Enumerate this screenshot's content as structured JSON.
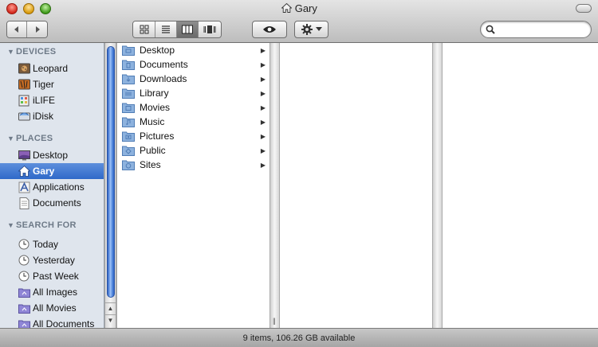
{
  "window": {
    "title": "Gary",
    "title_icon": "home-icon"
  },
  "toolbar": {
    "back_icon": "back-arrow-icon",
    "forward_icon": "forward-arrow-icon",
    "view_modes": [
      {
        "name": "icon-view",
        "active": false
      },
      {
        "name": "list-view",
        "active": false
      },
      {
        "name": "column-view",
        "active": true
      },
      {
        "name": "cover-flow-view",
        "active": false
      }
    ],
    "quick_look_icon": "eye-icon",
    "action_icon": "gear-icon",
    "search": {
      "value": "",
      "placeholder": ""
    }
  },
  "sidebar": {
    "devices_header": "DEVICES",
    "devices": [
      {
        "label": "Leopard",
        "icon": "hard-drive-icon"
      },
      {
        "label": "Tiger",
        "icon": "hard-drive-icon"
      },
      {
        "label": "iLIFE",
        "icon": "disk-image-icon"
      },
      {
        "label": "iDisk",
        "icon": "idisk-icon"
      }
    ],
    "places_header": "PLACES",
    "places": [
      {
        "label": "Desktop",
        "icon": "desktop-icon",
        "selected": false
      },
      {
        "label": "Gary",
        "icon": "home-icon",
        "selected": true
      },
      {
        "label": "Applications",
        "icon": "applications-icon",
        "selected": false
      },
      {
        "label": "Documents",
        "icon": "document-icon",
        "selected": false
      }
    ],
    "search_header": "SEARCH FOR",
    "searches": [
      {
        "label": "Today",
        "icon": "clock-icon"
      },
      {
        "label": "Yesterday",
        "icon": "clock-icon"
      },
      {
        "label": "Past Week",
        "icon": "clock-icon"
      },
      {
        "label": "All Images",
        "icon": "smart-folder-icon"
      },
      {
        "label": "All Movies",
        "icon": "smart-folder-icon"
      },
      {
        "label": "All Documents",
        "icon": "smart-folder-icon"
      }
    ]
  },
  "column1": {
    "items": [
      {
        "label": "Desktop",
        "icon": "folder-icon"
      },
      {
        "label": "Documents",
        "icon": "folder-icon"
      },
      {
        "label": "Downloads",
        "icon": "folder-icon"
      },
      {
        "label": "Library",
        "icon": "folder-icon"
      },
      {
        "label": "Movies",
        "icon": "folder-icon"
      },
      {
        "label": "Music",
        "icon": "folder-icon"
      },
      {
        "label": "Pictures",
        "icon": "folder-icon"
      },
      {
        "label": "Public",
        "icon": "folder-icon"
      },
      {
        "label": "Sites",
        "icon": "folder-icon"
      }
    ]
  },
  "status": {
    "text": "9 items, 106.26 GB available"
  },
  "colors": {
    "sidebar_bg": "#dfe5ed",
    "selection": "#3a73cf",
    "section_header": "#6e7a88"
  }
}
